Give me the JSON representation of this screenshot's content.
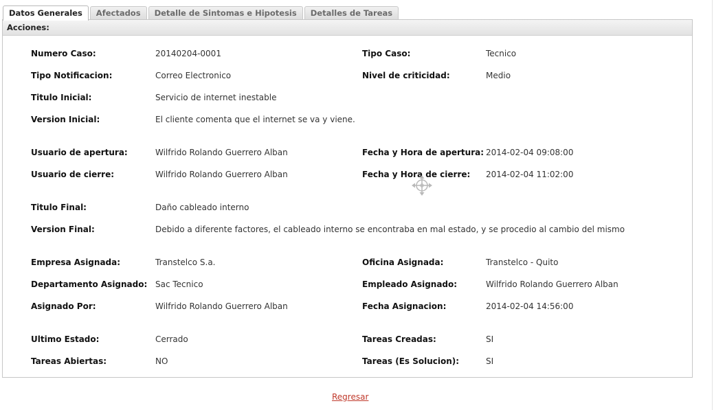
{
  "tabs": [
    {
      "label": "Datos Generales",
      "active": true
    },
    {
      "label": "Afectados",
      "active": false
    },
    {
      "label": "Detalle de Sintomas e Hipotesis",
      "active": false
    },
    {
      "label": "Detalles de Tareas",
      "active": false
    }
  ],
  "panel": {
    "header": "Acciones:"
  },
  "fields": {
    "numero_caso": {
      "label": "Numero Caso:",
      "value": "20140204-0001"
    },
    "tipo_caso": {
      "label": "Tipo Caso:",
      "value": "Tecnico"
    },
    "tipo_notificacion": {
      "label": "Tipo Notificacion:",
      "value": "Correo Electronico"
    },
    "nivel_criticidad": {
      "label": "Nivel de criticidad:",
      "value": "Medio"
    },
    "titulo_inicial": {
      "label": "Titulo Inicial:",
      "value": "Servicio de internet inestable"
    },
    "version_inicial": {
      "label": "Version Inicial:",
      "value": "El cliente comenta que el internet se va y viene."
    },
    "usuario_apertura": {
      "label": "Usuario de apertura:",
      "value": "Wilfrido Rolando Guerrero Alban"
    },
    "fecha_apertura": {
      "label": "Fecha y Hora de apertura:",
      "value": "2014-02-04 09:08:00"
    },
    "usuario_cierre": {
      "label": "Usuario de cierre:",
      "value": "Wilfrido Rolando Guerrero Alban"
    },
    "fecha_cierre": {
      "label": "Fecha y Hora de cierre:",
      "value": "2014-02-04 11:02:00"
    },
    "titulo_final": {
      "label": "Titulo Final:",
      "value": "Daño cableado interno"
    },
    "version_final": {
      "label": "Version Final:",
      "value": "Debido a diferente factores, el cableado interno se encontraba en mal estado, y se procedio al cambio del mismo"
    },
    "empresa_asignada": {
      "label": "Empresa Asignada:",
      "value": "Transtelco S.a."
    },
    "oficina_asignada": {
      "label": "Oficina Asignada:",
      "value": "Transtelco - Quito"
    },
    "departamento_asignado": {
      "label": "Departamento Asignado:",
      "value": "Sac Tecnico"
    },
    "empleado_asignado": {
      "label": "Empleado Asignado:",
      "value": "Wilfrido Rolando Guerrero Alban"
    },
    "asignado_por": {
      "label": "Asignado Por:",
      "value": "Wilfrido Rolando Guerrero Alban"
    },
    "fecha_asignacion": {
      "label": "Fecha Asignacion:",
      "value": "2014-02-04 14:56:00"
    },
    "ultimo_estado": {
      "label": "Ultimo Estado:",
      "value": "Cerrado"
    },
    "tareas_creadas": {
      "label": "Tareas Creadas:",
      "value": "SI"
    },
    "tareas_abiertas": {
      "label": "Tareas Abiertas:",
      "value": "NO"
    },
    "tareas_solucion": {
      "label": "Tareas (Es Solucion):",
      "value": "SI"
    }
  },
  "footer": {
    "back_link": "Regresar"
  },
  "icons": {
    "move": "move-cursor-icon"
  }
}
